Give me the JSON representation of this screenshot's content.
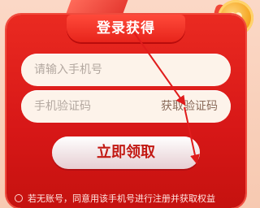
{
  "login_title": "登录获得",
  "phone_placeholder": "请输入手机号",
  "code_placeholder": "手机验证码",
  "get_code_label": "获取验证码",
  "submit_label": "立即领取",
  "agreement_text": "若无账号，同意用该手机号进行注册并获取权益",
  "colors": {
    "card_red": "#d71717",
    "button_text": "#c21913",
    "arrow_red": "#e01c1c"
  }
}
